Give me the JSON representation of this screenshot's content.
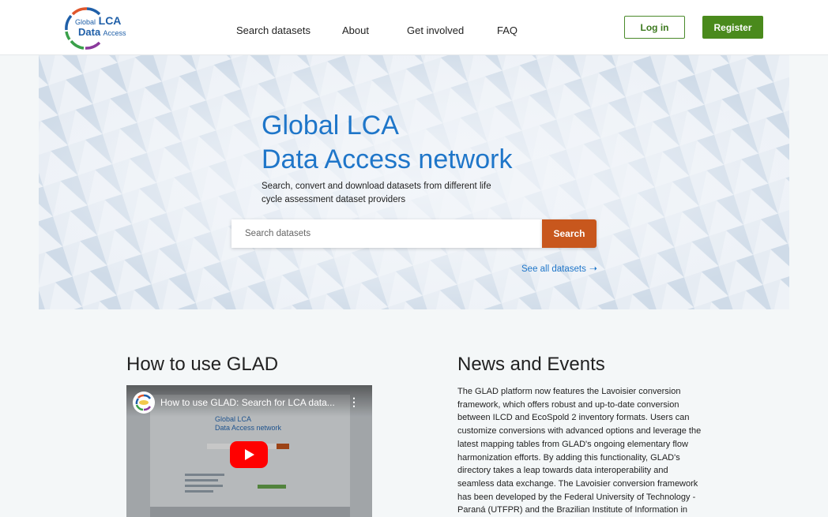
{
  "header": {
    "logo": {
      "line1_small": "Global",
      "line1_big": "LCA",
      "line2_big": "Data",
      "line2_small": "Access"
    },
    "nav": [
      {
        "label": "Search datasets"
      },
      {
        "label": "About"
      },
      {
        "label": "Get involved"
      },
      {
        "label": "FAQ"
      }
    ],
    "login_label": "Log in",
    "register_label": "Register"
  },
  "hero": {
    "title_line1": "Global LCA",
    "title_line2": "Data Access network",
    "subtitle": "Search, convert and download datasets from different life cycle assessment dataset providers",
    "search": {
      "placeholder": "Search datasets",
      "value": "",
      "button_label": "Search"
    },
    "see_all_label": "See all datasets",
    "see_all_icon": "arrow-right-icon"
  },
  "how_to": {
    "title": "How to use GLAD",
    "video": {
      "title": "How to use GLAD: Search for LCA data...",
      "inner_title_line1": "Global LCA",
      "inner_title_line2": "Data Access network",
      "play_icon": "play-icon",
      "menu_icon": "more-vert-icon"
    }
  },
  "news": {
    "title": "News and Events",
    "body": "The GLAD platform now features the Lavoisier conversion framework, which offers robust and up-to-date conversion between ILCD and EcoSpold 2 inventory formats. Users can customize conversions with advanced options and leverage the latest mapping tables from GLAD's ongoing elementary flow harmonization efforts. By adding this functionality, GLAD's directory takes a leap towards data interoperability and seamless data exchange. The Lavoisier conversion framework has been developed by the Federal University of Technology - Paraná (UTFPR) and the Brazilian Institute of Information in"
  },
  "colors": {
    "brand_blue": "#1f76c9",
    "brand_green": "#4a8a1c",
    "search_orange": "#c8571d",
    "page_bg": "#f4f7f8"
  }
}
